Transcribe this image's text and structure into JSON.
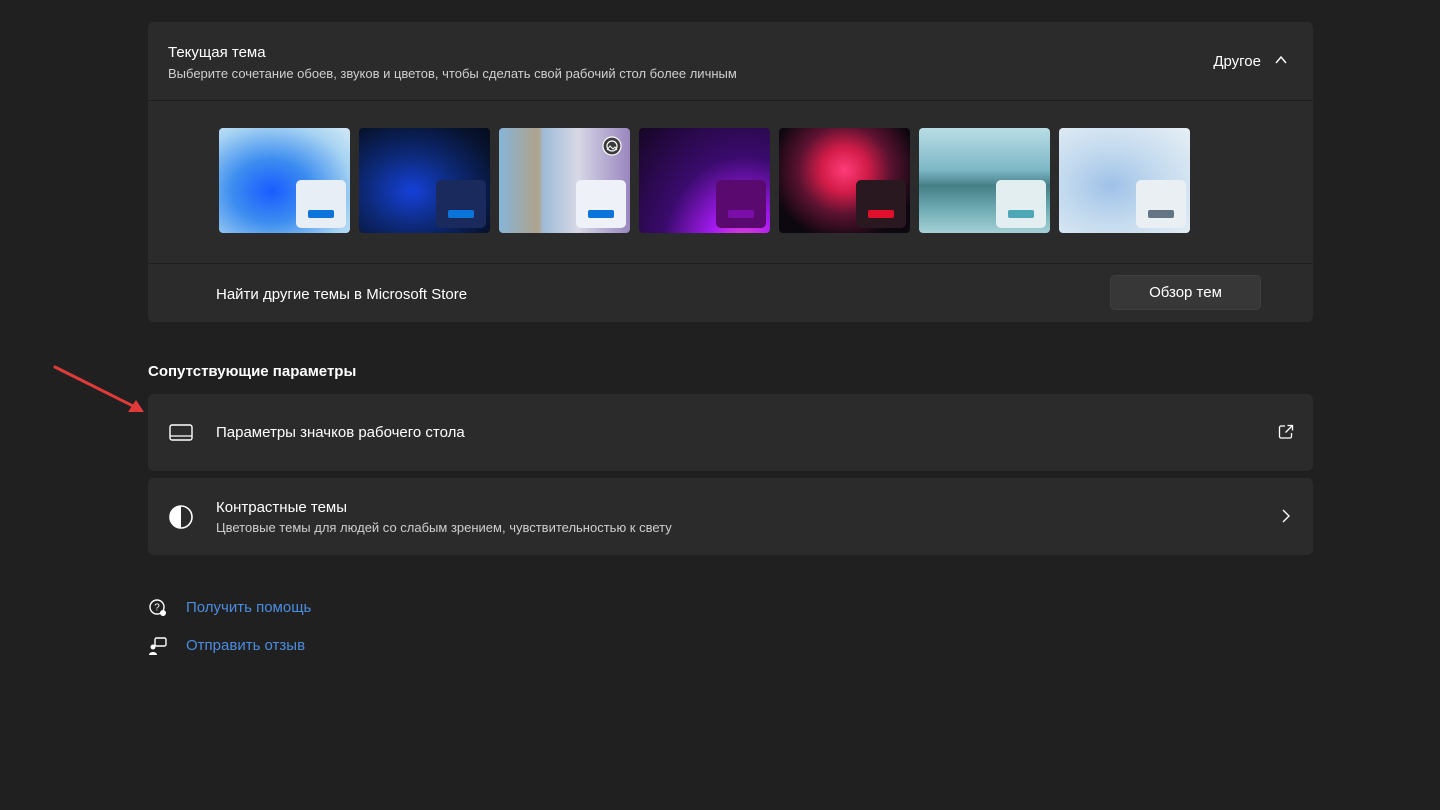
{
  "theme_section": {
    "title": "Текущая тема",
    "subtitle": "Выберите сочетание обоев, звуков и цветов, чтобы сделать свой рабочий стол более личным",
    "current_value": "Другое",
    "thumbnails": [
      {
        "name": "windows-light",
        "accent": "#0a74da",
        "mini_bg": "#e8eef5"
      },
      {
        "name": "windows-dark",
        "accent": "#0a74da",
        "mini_bg": "#1a2a5c"
      },
      {
        "name": "glow",
        "accent": "#0a74da",
        "mini_bg": "#eef1f7"
      },
      {
        "name": "captured-motion",
        "accent": "#7a0ea8",
        "mini_bg": "#5a0a6e"
      },
      {
        "name": "flow",
        "accent": "#e0102a",
        "mini_bg": "#2a1820"
      },
      {
        "name": "sunrise",
        "accent": "#4ea7b6",
        "mini_bg": "#e3eef1"
      },
      {
        "name": "windows-spotlight",
        "accent": "#637585",
        "mini_bg": "#eaeff4"
      }
    ],
    "store_label": "Найти другие темы в Microsoft Store",
    "browse_button": "Обзор тем"
  },
  "related": {
    "title": "Сопутствующие параметры",
    "desktop_icons": {
      "label": "Параметры значков рабочего стола",
      "icon": "monitor-icon",
      "end_icon": "external-link-icon"
    },
    "contrast": {
      "label": "Контрастные темы",
      "sublabel": "Цветовые темы для людей со слабым зрением, чувствительностью к свету",
      "icon": "contrast-icon",
      "end_icon": "chevron-right-icon"
    }
  },
  "links": {
    "help": "Получить помощь",
    "feedback": "Отправить отзыв"
  },
  "colors": {
    "background": "#202020",
    "card": "#2b2b2b",
    "link": "#4b8de0",
    "annotation_arrow": "#e03a3a"
  }
}
